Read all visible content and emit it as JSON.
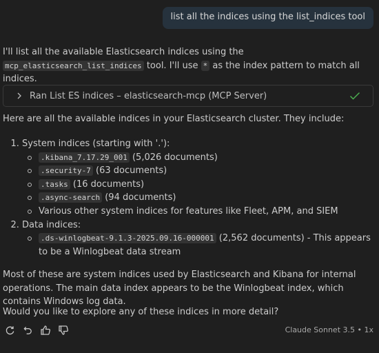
{
  "user_message": "list all the indices using the list_indices tool",
  "response": {
    "p1_before": "I'll list all the available Elasticsearch indices using the ",
    "p1_code": "mcp_elasticsearch_list_indices",
    "p1_mid": " tool. I'll use ",
    "p1_code2": "*",
    "p1_after": " as the index pattern to match all indices.",
    "tool_label": "Ran List ES indices – elasticsearch-mcp (MCP Server)",
    "intro": "Here are all the available indices in your Elasticsearch cluster. They include:",
    "group1_label": "System indices (starting with '.'):",
    "group1_items": [
      {
        "code": ".kibana_7.17.29_001",
        "text": " (5,026 documents)"
      },
      {
        "code": ".security-7",
        "text": " (63 documents)"
      },
      {
        "code": ".tasks",
        "text": " (16 documents)"
      },
      {
        "code": ".async-search",
        "text": " (94 documents)"
      }
    ],
    "group1_other": "Various other system indices for features like Fleet, APM, and SIEM",
    "group2_label": "Data indices:",
    "group2_code": ".ds-winlogbeat-9.1.3-2025.09.16-000001",
    "group2_text": " (2,562 documents) - This appears to be a Winlogbeat data stream",
    "summary": "Most of these are system indices used by Elasticsearch and Kibana for internal operations. The main data index appears to be the Winlogbeat index, which contains Windows log data.",
    "question": "Would you like to explore any of these indices in more detail?"
  },
  "footer": {
    "model": "Claude Sonnet 3.5 • 1x",
    "icons": [
      "retry-icon",
      "undo-icon",
      "thumbs-up-icon",
      "thumbs-down-icon"
    ]
  },
  "colors": {
    "background": "#1f1f1f",
    "user_bubble": "#26323d",
    "check": "#4caf50"
  }
}
